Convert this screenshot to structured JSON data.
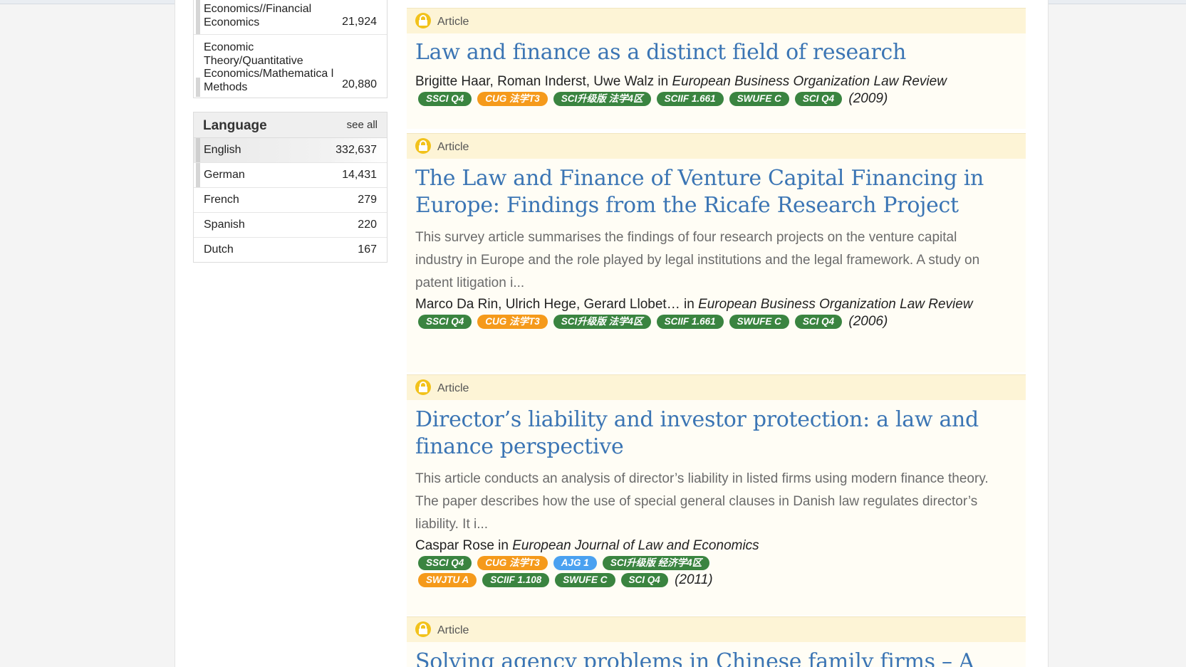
{
  "sidebar": {
    "subject_rows": [
      {
        "name": "Economics//Financial Economics",
        "count": "21,924"
      },
      {
        "name": "Economic Theory/Quantitative Economics/Mathematica l Methods",
        "count": "20,880"
      }
    ],
    "language": {
      "title": "Language",
      "see_all": "see all",
      "items": [
        {
          "name": "English",
          "count": "332,637"
        },
        {
          "name": "German",
          "count": "14,431"
        },
        {
          "name": "French",
          "count": "279"
        },
        {
          "name": "Spanish",
          "count": "220"
        },
        {
          "name": "Dutch",
          "count": "167"
        }
      ]
    }
  },
  "results": [
    {
      "type": "Article",
      "title": "Law and finance as a distinct field of research",
      "authors": "Brigitte Haar, Roman Inderst, Uwe Walz",
      "in": "in",
      "journal": "European Business Organization Law Review",
      "badges": [
        "SSCI Q4",
        "CUG 法学T3",
        "SCI升级版 法学4区",
        "SCIIF 1.661",
        "SWUFE C",
        "SCI Q4"
      ],
      "year": "(2009)"
    },
    {
      "type": "Article",
      "title": "The Law and Finance of Venture Capital Financing in Europe: Findings from the Ricafe Research Project",
      "abstract": "This survey article summarises the findings of four research projects on the venture capital industry in Europe and the role played by legal institutions and the legal framework. A study on patent litigation i...",
      "authors": "Marco Da Rin, Ulrich Hege, Gerard Llobet…",
      "in": "in",
      "journal": "European Business Organization Law Review",
      "badges": [
        "SSCI Q4",
        "CUG 法学T3",
        "SCI升级版 法学4区",
        "SCIIF 1.661",
        "SWUFE C",
        "SCI Q4"
      ],
      "year": "(2006)"
    },
    {
      "type": "Article",
      "title": "Director’s liability and investor protection: a law and finance perspective",
      "abstract": "This article conducts an analysis of director’s liability in listed firms using modern finance theory. The paper describes how the use of special general clauses in Danish law regulates director’s liability. It i...",
      "authors": "Caspar Rose",
      "in": "in",
      "journal": "European Journal of Law and Economics",
      "badges": [
        "SSCI Q4",
        "CUG 法学T3",
        "AJG 1",
        "SCI升级版 经济学4区",
        "SWJTU A",
        "SCIIF 1.108",
        "SWUFE C",
        "SCI Q4"
      ],
      "year": "(2011)"
    },
    {
      "type": "Article",
      "title": "Solving agency problems in Chinese family firms – A"
    }
  ],
  "colors": {
    "badge_green": "#3a8440",
    "badge_orange": "#f59a1b",
    "badge_blue": "#4aa1f0",
    "title_link": "#3b75b4",
    "lock_icon": "#f2c21b"
  }
}
